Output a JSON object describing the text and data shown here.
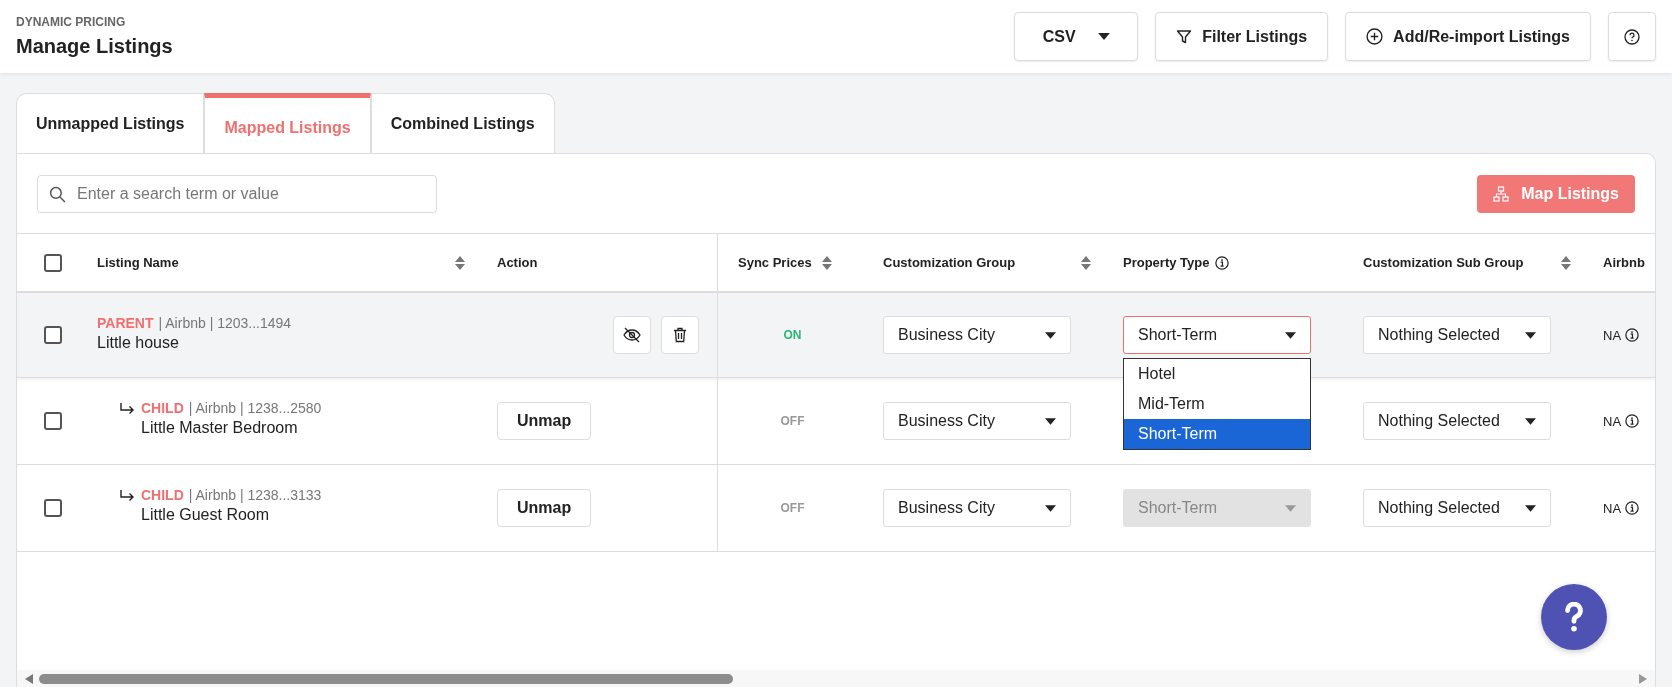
{
  "header": {
    "eyebrow": "DYNAMIC PRICING",
    "title": "Manage Listings",
    "export": {
      "label": "CSV"
    },
    "filter_button": "Filter Listings",
    "add_button": "Add/Re-import Listings"
  },
  "tabs": [
    {
      "label": "Unmapped Listings",
      "selected": false
    },
    {
      "label": "Mapped Listings",
      "selected": true
    },
    {
      "label": "Combined Listings",
      "selected": false
    }
  ],
  "search": {
    "placeholder": "Enter a search term or value"
  },
  "map_button": "Map Listings",
  "table": {
    "columns": [
      {
        "label": "Listing Name",
        "kind": "sortable"
      },
      {
        "label": "Action",
        "kind": "plain"
      },
      {
        "label": "Sync Prices",
        "kind": "sortable"
      },
      {
        "label": "Customization Group",
        "kind": "sortable"
      },
      {
        "label": "Property Type",
        "kind": "info"
      },
      {
        "label": "Customization Sub Group",
        "kind": "sortable"
      },
      {
        "label": "Airbnb",
        "kind": "plain"
      }
    ],
    "header_checked": false,
    "rows": [
      {
        "kind": "parent",
        "checked": false,
        "tag": "PARENT",
        "meta": "| Airbnb | 1203...1494",
        "name": "Little house",
        "sync": "ON",
        "sync_on": true,
        "group": "Business City",
        "property_type": {
          "value": "Short-Term",
          "disabled": false,
          "open": true,
          "options": [
            {
              "label": "Hotel",
              "selected": false
            },
            {
              "label": "Mid-Term",
              "selected": false
            },
            {
              "label": "Short-Term",
              "selected": true
            }
          ]
        },
        "sub_group": "Nothing Selected",
        "airbnb": "NA"
      },
      {
        "kind": "child",
        "checked": false,
        "tag": "CHILD",
        "meta": "| Airbnb | 1238...2580",
        "name": "Little Master Bedroom",
        "action": "Unmap",
        "sync": "OFF",
        "sync_on": false,
        "group": "Business City",
        "sub_group": "Nothing Selected",
        "airbnb": "NA"
      },
      {
        "kind": "child",
        "checked": false,
        "tag": "CHILD",
        "meta": "| Airbnb | 1238...3133",
        "name": "Little Guest Room",
        "action": "Unmap",
        "sync": "OFF",
        "sync_on": false,
        "group": "Business City",
        "property_type": {
          "value": "Short-Term",
          "disabled": true,
          "open": false
        },
        "sub_group": "Nothing Selected",
        "airbnb": "NA"
      }
    ]
  }
}
